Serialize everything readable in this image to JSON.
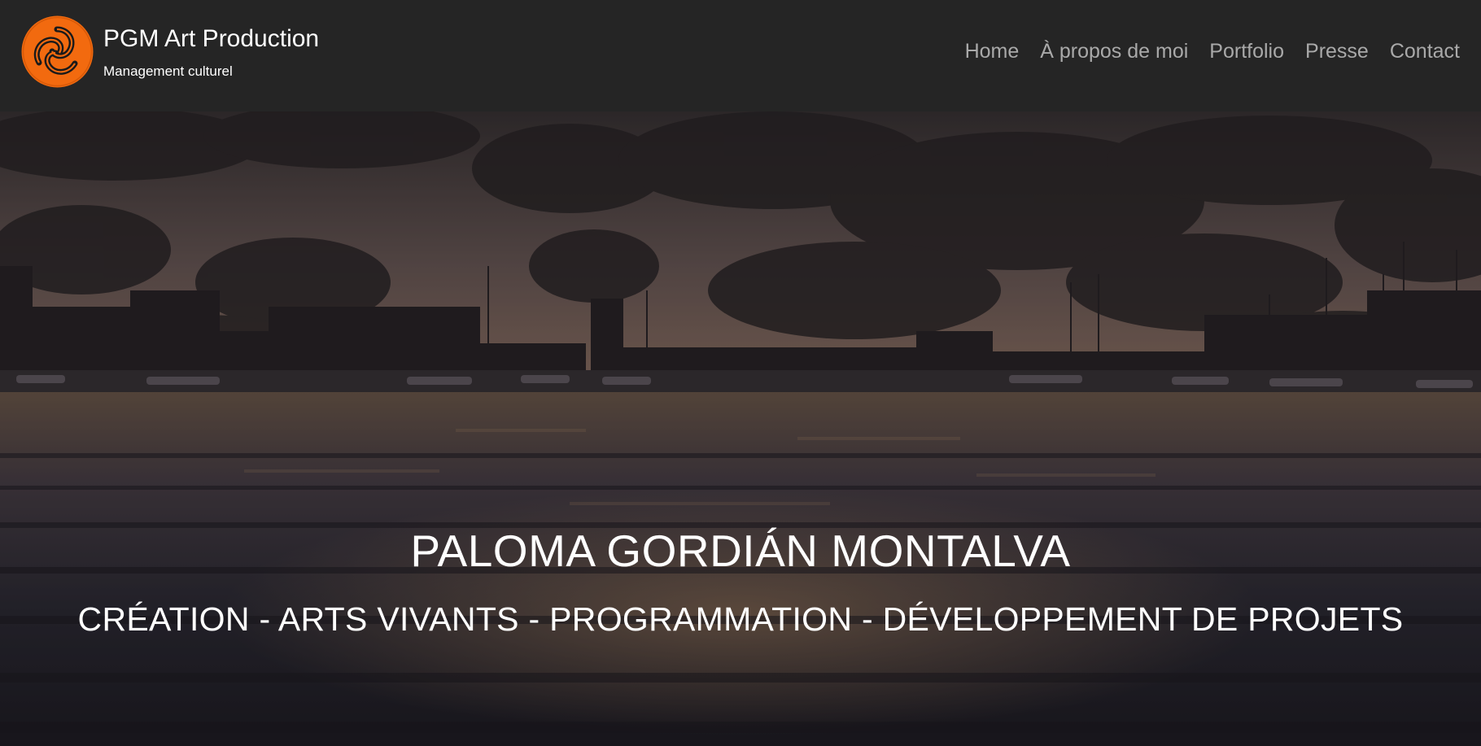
{
  "brand": {
    "title": "PGM Art Production",
    "tagline": "Management culturel",
    "logo_icon": "pgm-knot-logo-icon",
    "logo_color": "#f26a0f"
  },
  "nav": {
    "items": [
      {
        "label": "Home"
      },
      {
        "label": "À propos de moi"
      },
      {
        "label": "Portfolio"
      },
      {
        "label": "Presse"
      },
      {
        "label": "Contact"
      }
    ]
  },
  "hero": {
    "name": "PALOMA GORDIÁN MONTALVA",
    "subtitle": "CRÉATION - ARTS VIVANTS - PROGRAMMATION - DÉVELOPPEMENT DE PROJETS",
    "background_image": "harbor-sunset-image"
  },
  "colors": {
    "header_bg": "#252525",
    "nav_text": "#a9a9a9",
    "brand_text": "#ffffff",
    "hero_text": "#ffffff"
  }
}
